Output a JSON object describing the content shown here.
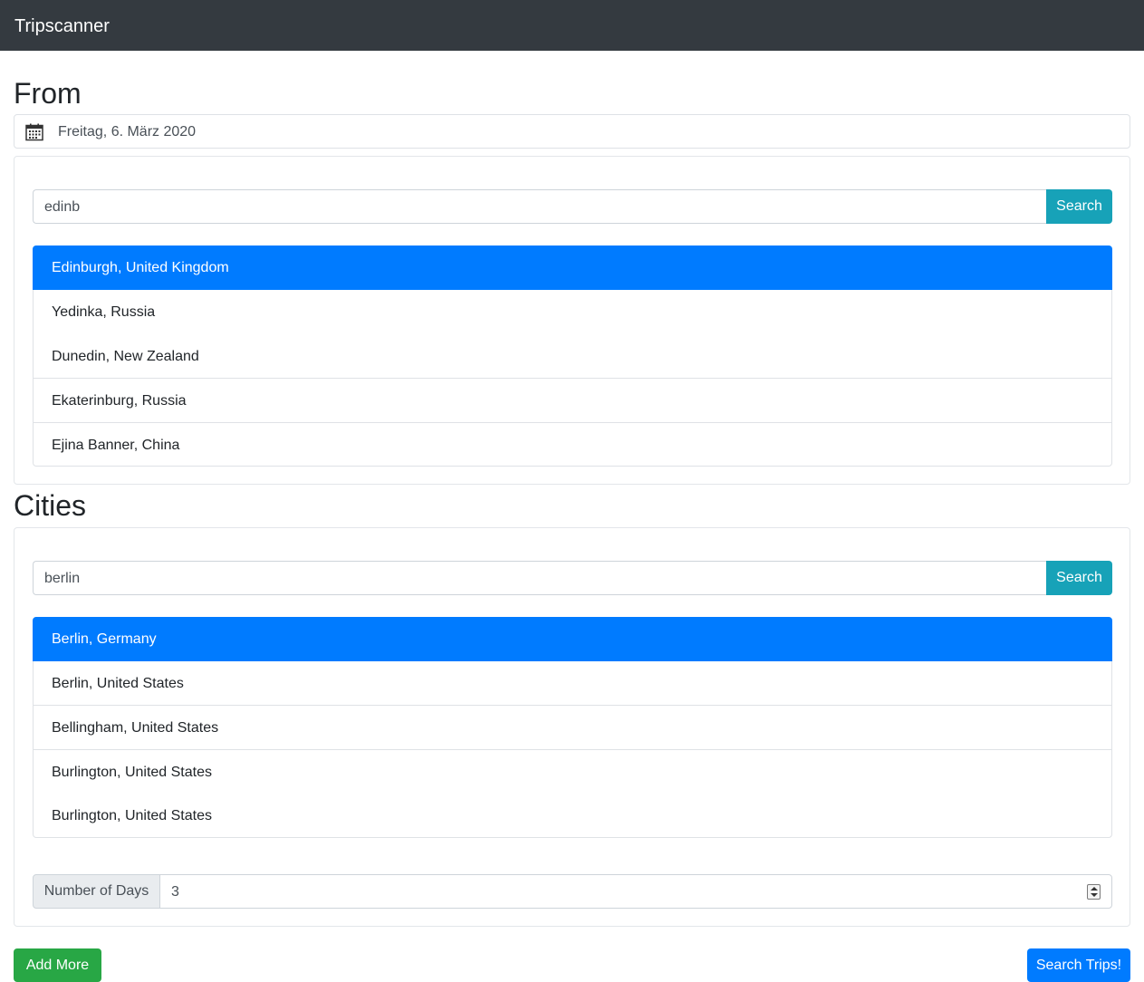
{
  "app": {
    "brand": "Tripscanner"
  },
  "from_section": {
    "heading": "From",
    "date_value": "Freitag, 6. März 2020",
    "search": {
      "value": "edinb",
      "button_label": "Search"
    },
    "results": [
      "Edinburgh, United Kingdom",
      "Yedinka, Russia",
      "Dunedin, New Zealand",
      "Ekaterinburg, Russia",
      "Ejina Banner, China"
    ],
    "selected_index": 0
  },
  "cities_section": {
    "heading": "Cities",
    "search": {
      "value": "berlin",
      "button_label": "Search"
    },
    "results": [
      "Berlin, Germany",
      "Berlin, United States",
      "Bellingham, United States",
      "Burlington, United States",
      "Burlington, United States"
    ],
    "selected_index": 0,
    "days": {
      "label": "Number of Days",
      "value": "3"
    }
  },
  "actions": {
    "add_more_label": "Add More",
    "search_trips_label": "Search Trips!"
  },
  "colors": {
    "navbar": "#343a40",
    "active_item": "#007bff",
    "search_button": "#17a2b8",
    "add_button": "#28a745",
    "primary_button": "#007bff"
  },
  "icons": {
    "date": "calendar-icon",
    "number_spinner": "spinner-arrows-icon"
  }
}
